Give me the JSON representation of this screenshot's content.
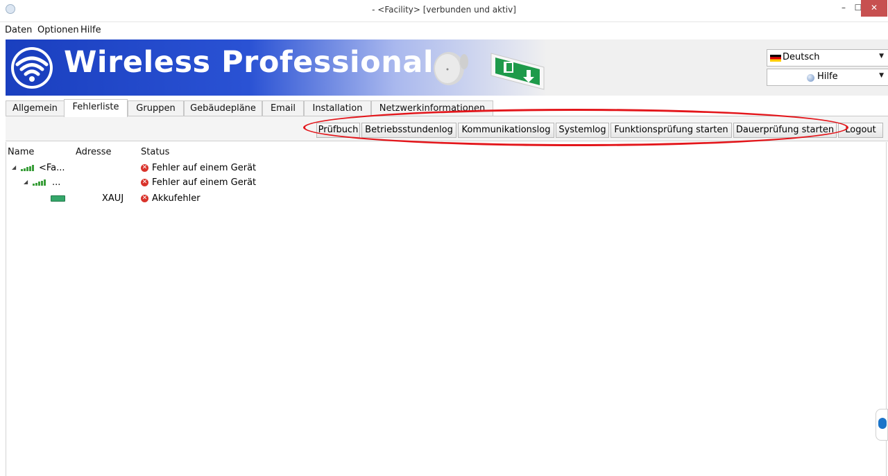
{
  "window": {
    "title": "- <Facility> [verbunden und aktiv]",
    "controls": {
      "minimize": "–",
      "maximize": "☐",
      "close": "✕"
    }
  },
  "menu": [
    "Daten",
    "Optionen",
    "Hilfe"
  ],
  "banner": {
    "brand": "Wireless Professional",
    "language_select": "Deutsch",
    "help_select": "Hilfe"
  },
  "tabs": [
    "Allgemein",
    "Fehlerliste",
    "Gruppen",
    "Gebäudepläne",
    "Email",
    "Installation",
    "Netzwerkinformationen"
  ],
  "active_tab": "Fehlerliste",
  "toolbar": {
    "buttons": [
      "Prüfbuch",
      "Betriebsstundenlog",
      "Kommunikationslog",
      "Systemlog",
      "Funktionsprüfung starten",
      "Dauerprüfung starten",
      "Logout"
    ]
  },
  "grid": {
    "headers": {
      "name": "Name",
      "address": "Adresse",
      "status": "Status"
    },
    "rows": [
      {
        "name": "<Fa...",
        "address": "",
        "status": "Fehler auf einem Gerät",
        "icon": "wifi-signal-icon"
      },
      {
        "name": "...",
        "address": "",
        "status": "Fehler auf einem Gerät",
        "icon": "wifi-signal-icon"
      },
      {
        "name": "",
        "address": "XAUJ",
        "status": "Akkufehler",
        "icon": "battery-icon"
      }
    ]
  },
  "colors": {
    "banner_blue": "#1a3fbf",
    "highlight": "#e3161b",
    "error": "#d9332b",
    "device_green": "#35a66a"
  }
}
